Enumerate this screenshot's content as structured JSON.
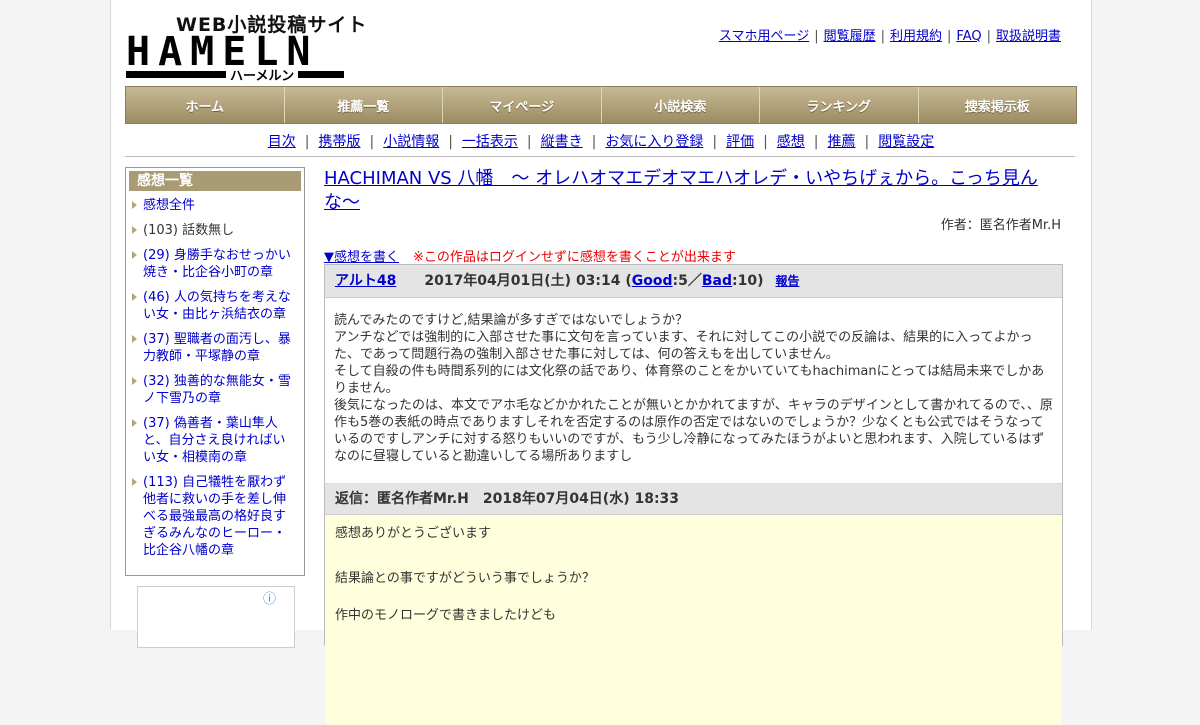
{
  "header": {
    "logo_sub": "WEB小説投稿サイト",
    "logo_main": "HAMELN",
    "logo_kana": "ハーメルン",
    "top_links": [
      "スマホ用ページ",
      "閲覧履歴",
      "利用規約",
      "FAQ",
      "取扱説明書"
    ]
  },
  "nav": [
    "ホーム",
    "推薦一覧",
    "マイページ",
    "小説検索",
    "ランキング",
    "捜索掲示板"
  ],
  "subnav": [
    "目次",
    "携帯版",
    "小説情報",
    "一括表示",
    "縦書き",
    "お気に入り登録",
    "評価",
    "感想",
    "推薦",
    "閲覧設定"
  ],
  "sidebar": {
    "heading": "感想一覧",
    "items": [
      {
        "label": "感想全件",
        "link": true
      },
      {
        "label": "(103) 話数無し",
        "link": false
      },
      {
        "label": "(29) 身勝手なおせっかい焼き・比企谷小町の章",
        "link": true
      },
      {
        "label": "(46) 人の気持ちを考えない女・由比ヶ浜結衣の章",
        "link": true
      },
      {
        "label": "(37) 聖職者の面汚し、暴力教師・平塚静の章",
        "link": true
      },
      {
        "label": "(32) 独善的な無能女・雪ノ下雪乃の章",
        "link": true
      },
      {
        "label": "(37) 偽善者・葉山隼人と、自分さえ良ければいい女・相模南の章",
        "link": true
      },
      {
        "label": "(113) 自己犠牲を厭わず他者に救いの手を差し伸べる最強最高の格好良すぎるみんなのヒーロー・比企谷八幡の章",
        "link": true
      }
    ]
  },
  "novel": {
    "title": "HACHIMAN VS 八幡　〜 オレハオマエデオマエハオレデ・いやちげぇから。こっち見んな〜",
    "author": "作者：匿名作者Mr.H"
  },
  "write": {
    "link": "▼感想を書く",
    "warning": "※この作品はログインせずに感想を書くことが出来ます"
  },
  "post": {
    "user": "アルト48",
    "date": "2017年04月01日(土) 03:14 (",
    "good_label": "Good",
    "good_value": ":5／",
    "bad_label": "Bad",
    "bad_value": ":10)",
    "report": "報告",
    "body": [
      "読んでみたのですけど,結果論が多すぎではないでしょうか？",
      "アンチなどでは強制的に入部させた事に文句を言っています、それに対してこの小説での反論は、結果的に入ってよかった、であって問題行為の強制入部させた事に対しては、何の答えもを出していません。",
      "そして自殺の件も時間系列的には文化祭の話であり、体育祭のことをかいていてもhachimanにとっては結局未来でしかありません。",
      "後気になったのは、本文でアホ毛などかかれたことが無いとかかれてますが、キャラのデザインとして書かれてるので、、原作も5巻の表紙の時点でありますしそれを否定するのは原作の否定ではないのでしょうか？少なくとも公式ではそうなっているのですしアンチに対する怒りもいいのですが、もう少し冷静になってみたほうがよいと思われます、入院しているはずなのに昼寝していると勘違いしてる場所ありますし"
    ]
  },
  "reply": {
    "head": "返信：匿名作者Mr.H　2018年07月04日(水) 18:33",
    "lines": [
      "感想ありがとうございます",
      "結果論との事ですがどういう事でしょうか？",
      "作中のモノローグで書きましたけども"
    ]
  }
}
